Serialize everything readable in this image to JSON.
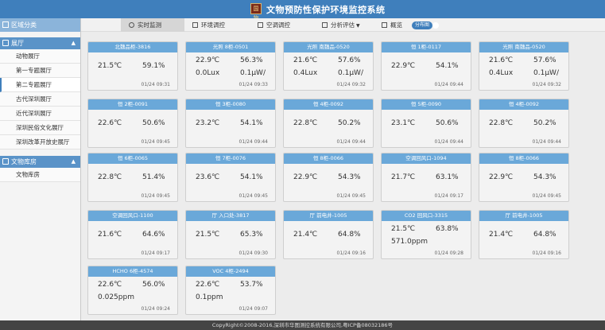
{
  "header": {
    "logo_text": "国物",
    "title": "文物预防性保护环境监控系统"
  },
  "sidebar": {
    "top_label": "区域分类",
    "sections": [
      {
        "label": "展厅",
        "items": [
          "动物展厅",
          "第一专题展厅",
          "第二专题展厅",
          "古代深圳展厅",
          "近代深圳展厅",
          "深圳民俗文化展厅",
          "深圳改革开放史展厅"
        ],
        "active_index": 2
      },
      {
        "label": "文物库房",
        "items": [
          "文物库房"
        ],
        "active_index": -1
      }
    ]
  },
  "toolbar": {
    "tabs": [
      "实时监测",
      "环境调控",
      "空调调控",
      "分析评估",
      "概览"
    ],
    "active_tab": 0,
    "toggle_label": "分布图"
  },
  "cards": [
    {
      "title": "北魏品柜-3816",
      "rows": [
        [
          "21.5℃",
          "59.1%"
        ]
      ],
      "time": "01/24 09:31"
    },
    {
      "title": "光照 8柜-0501",
      "rows": [
        [
          "22.9℃",
          "56.3%"
        ],
        [
          "0.0Lux",
          "0.1μW/"
        ]
      ],
      "time": "01/24 09:33"
    },
    {
      "title": "光照 南魏品-0520",
      "rows": [
        [
          "21.6℃",
          "57.6%"
        ],
        [
          "0.4Lux",
          "0.1μW/"
        ]
      ],
      "time": "01/24 09:32"
    },
    {
      "title": "恒 1柜-0117",
      "rows": [
        [
          "22.9℃",
          "54.1%"
        ]
      ],
      "time": "01/24 09:44"
    },
    {
      "title": "光照 南魏品-0520",
      "rows": [
        [
          "21.6℃",
          "57.6%"
        ],
        [
          "0.4Lux",
          "0.1μW/"
        ]
      ],
      "time": "01/24 09:32"
    },
    {
      "title": "恒 2柜-0091",
      "rows": [
        [
          "22.6℃",
          "50.6%"
        ]
      ],
      "time": "01/24 09:45"
    },
    {
      "title": "恒 3柜-0080",
      "rows": [
        [
          "23.2℃",
          "54.1%"
        ]
      ],
      "time": "01/24 09:44"
    },
    {
      "title": "恒 4柜-0092",
      "rows": [
        [
          "22.8℃",
          "50.2%"
        ]
      ],
      "time": "01/24 09:44"
    },
    {
      "title": "恒 5柜-0090",
      "rows": [
        [
          "23.1℃",
          "50.6%"
        ]
      ],
      "time": "01/24 09:44"
    },
    {
      "title": "恒 4柜-0092",
      "rows": [
        [
          "22.8℃",
          "50.2%"
        ]
      ],
      "time": "01/24 09:44"
    },
    {
      "title": "恒 6柜-0065",
      "rows": [
        [
          "22.8℃",
          "51.4%"
        ]
      ],
      "time": "01/24 09:45"
    },
    {
      "title": "恒 7柜-0076",
      "rows": [
        [
          "23.6℃",
          "54.1%"
        ]
      ],
      "time": "01/24 09:45"
    },
    {
      "title": "恒 8柜-0066",
      "rows": [
        [
          "22.9℃",
          "54.3%"
        ]
      ],
      "time": "01/24 09:45"
    },
    {
      "title": "空调回风口-1094",
      "rows": [
        [
          "21.7℃",
          "63.1%"
        ]
      ],
      "time": "01/24 09:17"
    },
    {
      "title": "恒 8柜-0066",
      "rows": [
        [
          "22.9℃",
          "54.3%"
        ]
      ],
      "time": "01/24 09:45"
    },
    {
      "title": "空调回风口-1100",
      "rows": [
        [
          "21.6℃",
          "64.6%"
        ]
      ],
      "time": "01/24 09:17"
    },
    {
      "title": "厅 入口处-3817",
      "rows": [
        [
          "21.5℃",
          "65.3%"
        ]
      ],
      "time": "01/24 09:30"
    },
    {
      "title": "厅 前电井-1005",
      "rows": [
        [
          "21.4℃",
          "64.8%"
        ]
      ],
      "time": "01/24 09:16"
    },
    {
      "title": "CO2 回风口-3315",
      "rows": [
        [
          "21.5℃",
          "63.8%"
        ],
        [
          "571.0ppm",
          ""
        ]
      ],
      "time": "01/24 09:28"
    },
    {
      "title": "厅 前电井-1005",
      "rows": [
        [
          "21.4℃",
          "64.8%"
        ]
      ],
      "time": "01/24 09:16"
    },
    {
      "title": "HCHO 6柜-4574",
      "rows": [
        [
          "22.6℃",
          "56.0%"
        ],
        [
          "0.025ppm",
          ""
        ]
      ],
      "time": "01/24 09:24"
    },
    {
      "title": "VOC 4柜-2494",
      "rows": [
        [
          "22.6℃",
          "53.7%"
        ],
        [
          "0.1ppm",
          ""
        ]
      ],
      "time": "01/24 09:07"
    }
  ],
  "footer": {
    "text": "CopyRight©2008-2016,深圳市华图测控系统有限公司,粤ICP备08032186号"
  },
  "colors": {
    "header": "#3f7fbc",
    "card_header": "#6aa8d9",
    "sidebar_section": "#5a93c8"
  }
}
